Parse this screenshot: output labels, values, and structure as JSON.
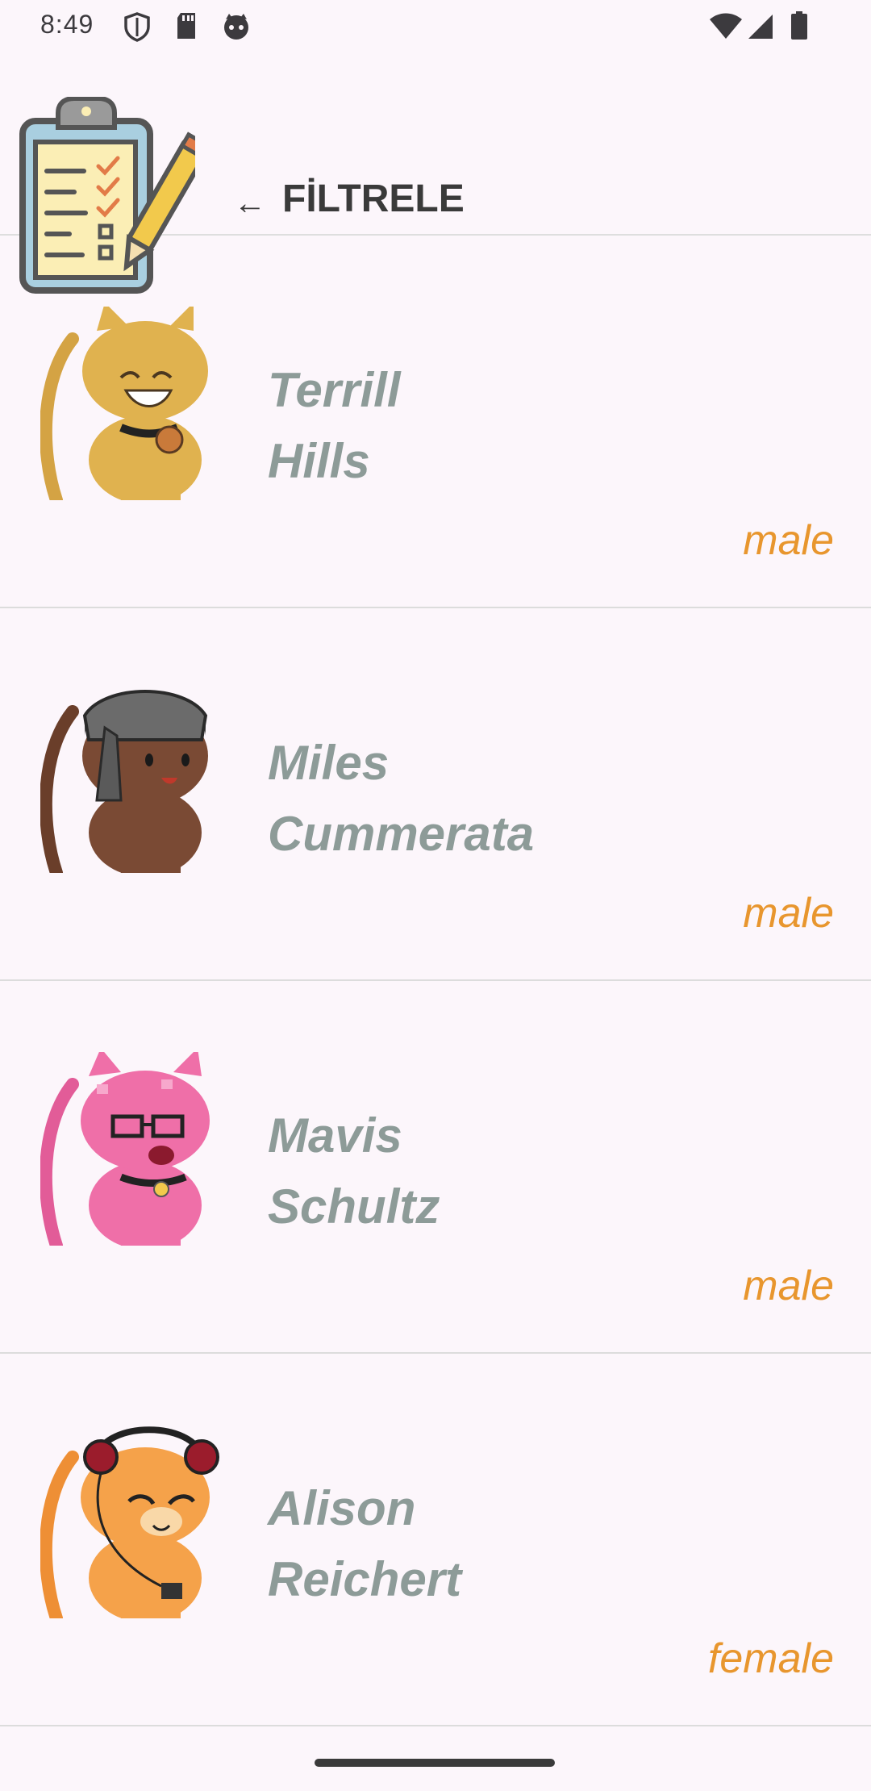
{
  "status_bar": {
    "time": "8:49",
    "left_icons": [
      "shield-icon",
      "sd-card-icon",
      "cat-face-icon"
    ],
    "right_icons": [
      "wifi-icon",
      "cell-signal-icon",
      "battery-icon"
    ]
  },
  "header": {
    "logo_icon": "clipboard-checklist-icon",
    "filter_arrow": "←",
    "filter_label": "FİLTRELE"
  },
  "items": [
    {
      "first_name": "Terrill",
      "last_name": "Hills",
      "gender": "male",
      "avatar": "yellow-cat",
      "color": "#e0b24f"
    },
    {
      "first_name": "Miles",
      "last_name": "Cummerata",
      "gender": "male",
      "avatar": "brown-cat-bandana",
      "color": "#7a4a34"
    },
    {
      "first_name": "Mavis",
      "last_name": "Schultz",
      "gender": "male",
      "avatar": "pink-cat-glasses",
      "color": "#ef6fa8"
    },
    {
      "first_name": "Alison",
      "last_name": "Reichert",
      "gender": "female",
      "avatar": "orange-cat-headphones",
      "color": "#f5a24a"
    }
  ]
}
